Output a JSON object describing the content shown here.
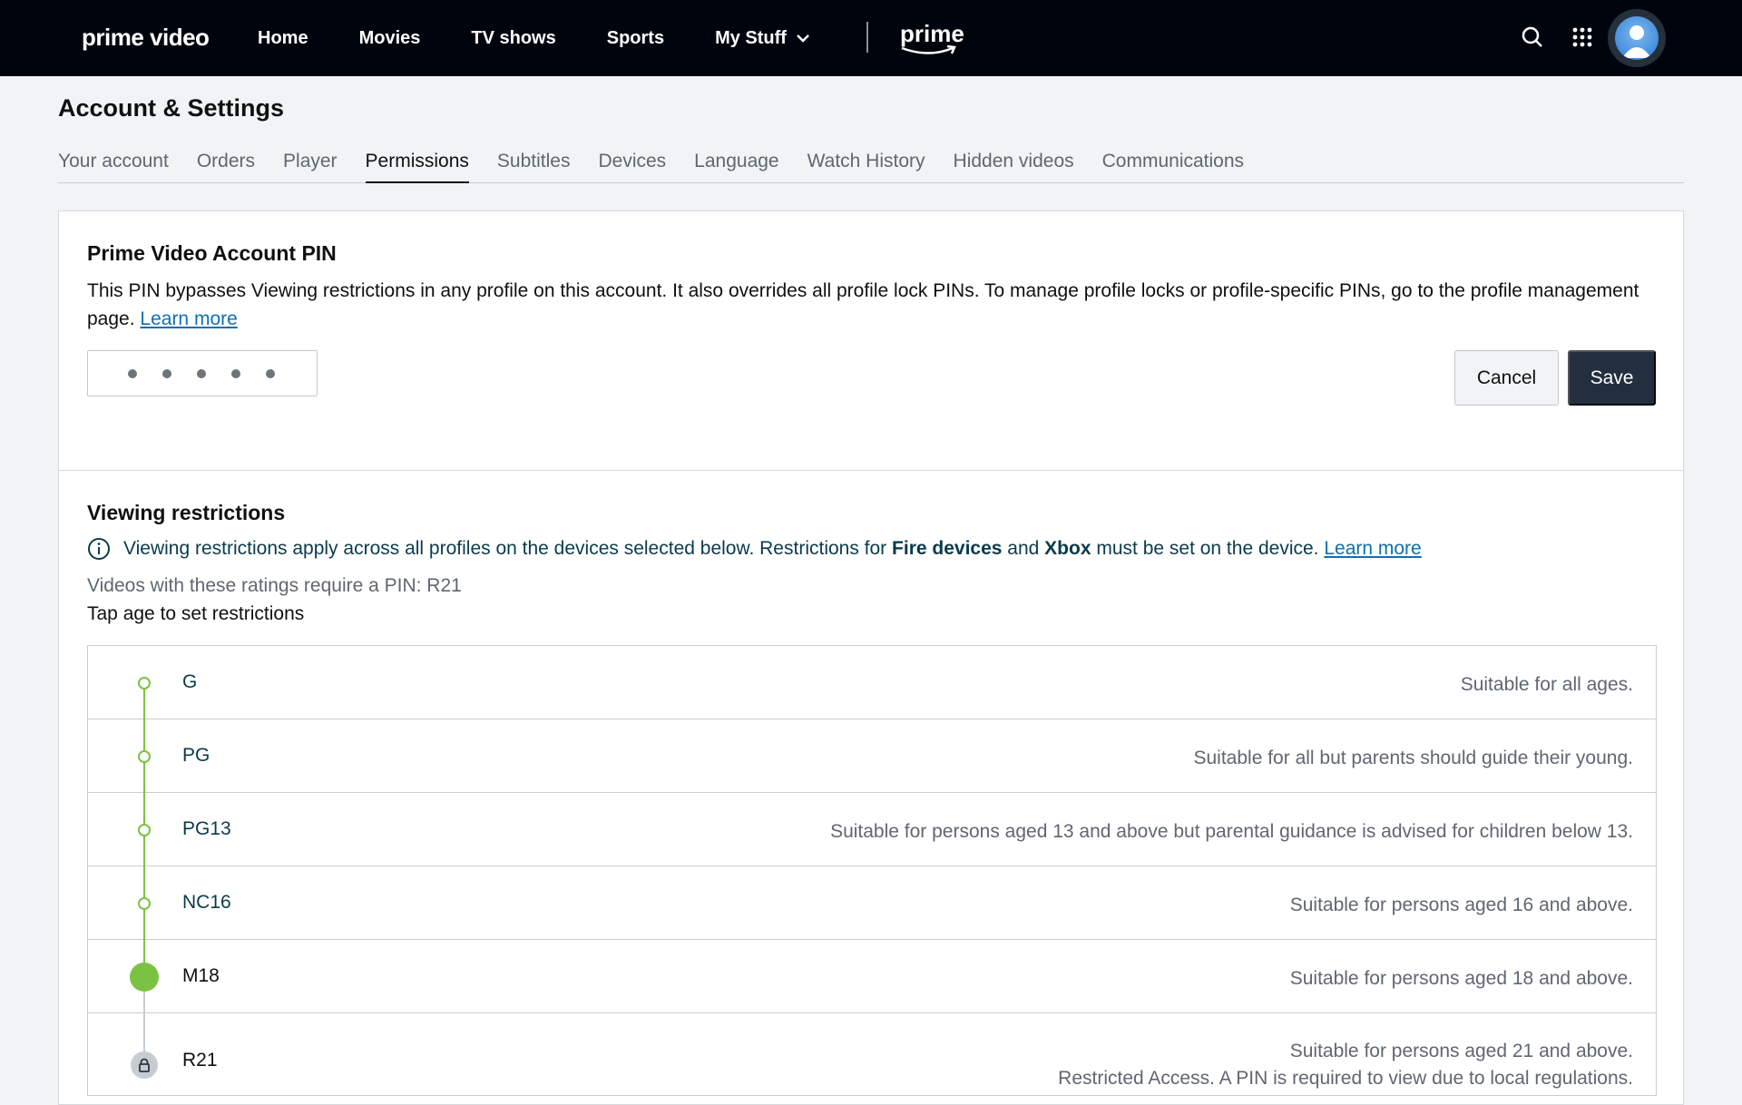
{
  "nav": {
    "logo": "prime video",
    "links": [
      "Home",
      "Movies",
      "TV shows",
      "Sports",
      "My Stuff"
    ],
    "prime_logo": "prime"
  },
  "page": {
    "title": "Account & Settings",
    "tabs": [
      "Your account",
      "Orders",
      "Player",
      "Permissions",
      "Subtitles",
      "Devices",
      "Language",
      "Watch History",
      "Hidden videos",
      "Communications"
    ],
    "active_tab": "Permissions"
  },
  "pin_card": {
    "title": "Prime Video Account PIN",
    "description": "This PIN bypasses Viewing restrictions in any profile on this account. It also overrides all profile lock PINs. To manage profile locks or profile-specific PINs, go to the profile management page.",
    "learn_more": "Learn more",
    "pin_value": "•••••",
    "cancel_label": "Cancel",
    "save_label": "Save"
  },
  "restrictions": {
    "title": "Viewing restrictions",
    "info_prefix": "Viewing restrictions apply across all profiles on the devices selected below. Restrictions for",
    "info_fire": "Fire devices",
    "info_and": "and",
    "info_xbox": "Xbox",
    "info_suffix": "must be set on the device.",
    "learn_more": "Learn more",
    "pin_ratings": "Videos with these ratings require a PIN: R21",
    "tap_age": "Tap age to set restrictions",
    "ratings": [
      {
        "code": "G",
        "desc": "Suitable for all ages."
      },
      {
        "code": "PG",
        "desc": "Suitable for all but parents should guide their young."
      },
      {
        "code": "PG13",
        "desc": "Suitable for persons aged 13 and above but parental guidance is advised for children below 13."
      },
      {
        "code": "NC16",
        "desc": "Suitable for persons aged 16 and above."
      },
      {
        "code": "M18",
        "desc": "Suitable for persons aged 18 and above."
      },
      {
        "code": "R21",
        "desc": "Suitable for persons aged 21 and above.",
        "desc2": "Restricted Access. A PIN is required to view due to local regulations."
      }
    ]
  },
  "colors": {
    "nav_bg": "#00050d",
    "accent_green": "#7cc242",
    "link_blue": "#0f6fb3",
    "save_bg": "#232f3e"
  },
  "icons": [
    "search-icon",
    "apps-grid-icon",
    "avatar",
    "chevron-down-icon",
    "info-icon",
    "lock-icon"
  ]
}
